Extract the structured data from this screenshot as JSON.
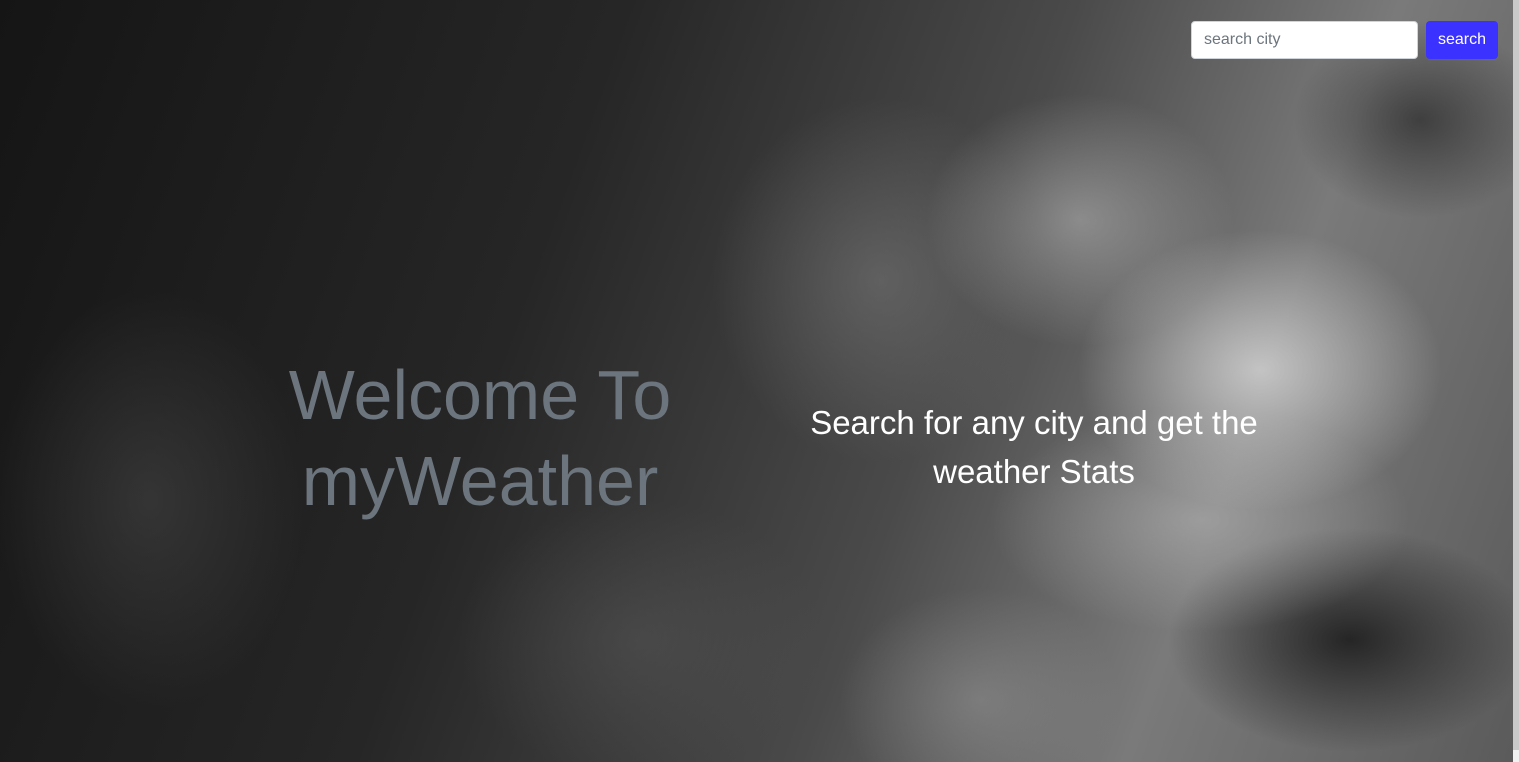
{
  "search": {
    "placeholder": "search city",
    "value": "",
    "button_label": "search",
    "button_color": "#3b32ff"
  },
  "hero": {
    "title_line1": "Welcome To",
    "title_line2": "myWeather",
    "title_color": "#6c757d",
    "tagline_line1": "Search for any city and get the",
    "tagline_line2": "weather Stats",
    "tagline_color": "#ffffff"
  },
  "background": {
    "description_icon": "cloudy-sky-background"
  }
}
